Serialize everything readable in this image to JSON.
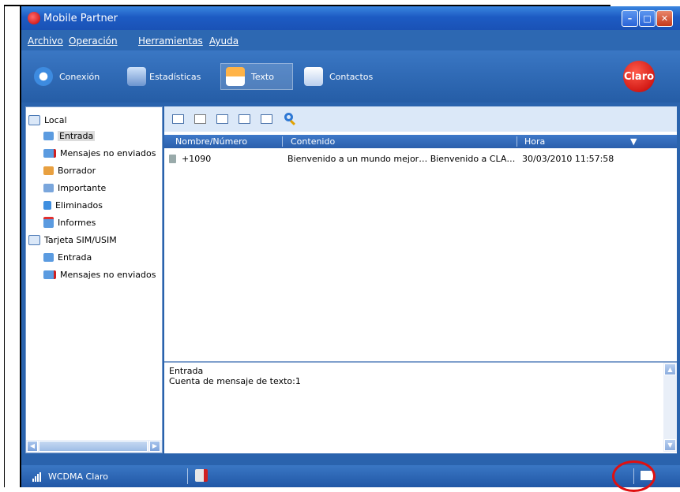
{
  "window": {
    "title": "Mobile Partner"
  },
  "menu": [
    "Archivo",
    "Operación",
    "Herramientas",
    "Ayuda"
  ],
  "toolbar": {
    "items": [
      {
        "label": "Conexión",
        "icon": "refresh-icon"
      },
      {
        "label": "Estadísticas",
        "icon": "monitor-icon"
      },
      {
        "label": "Texto",
        "icon": "envelope-icon",
        "active": true
      },
      {
        "label": "Contactos",
        "icon": "contacts-icon"
      }
    ],
    "brand": "Claro"
  },
  "sidebar": {
    "items": [
      {
        "label": "Local",
        "level": 0
      },
      {
        "label": "Entrada",
        "level": 1,
        "selected": true
      },
      {
        "label": "Mensajes no enviados",
        "level": 1
      },
      {
        "label": "Borrador",
        "level": 1
      },
      {
        "label": "Importante",
        "level": 1
      },
      {
        "label": "Eliminados",
        "level": 1
      },
      {
        "label": "Informes",
        "level": 1
      },
      {
        "label": "Tarjeta SIM/USIM",
        "level": 0
      },
      {
        "label": "Entrada",
        "level": 1
      },
      {
        "label": "Mensajes no enviados",
        "level": 1
      }
    ]
  },
  "list": {
    "columns": [
      "Nombre/Número",
      "Contenido",
      "Hora"
    ],
    "rows": [
      {
        "name": "+1090",
        "content": "Bienvenido a un mundo mejor… Bienvenido a CLA…",
        "time": "30/03/2010 11:57:58"
      }
    ]
  },
  "preview": {
    "folder": "Entrada",
    "count_text": "Cuenta de mensaje de texto:1"
  },
  "status": {
    "network": "WCDMA Claro"
  },
  "colors": {
    "accent": "#2a63ad",
    "highlight": "#e01010",
    "brand": "#c00000"
  }
}
